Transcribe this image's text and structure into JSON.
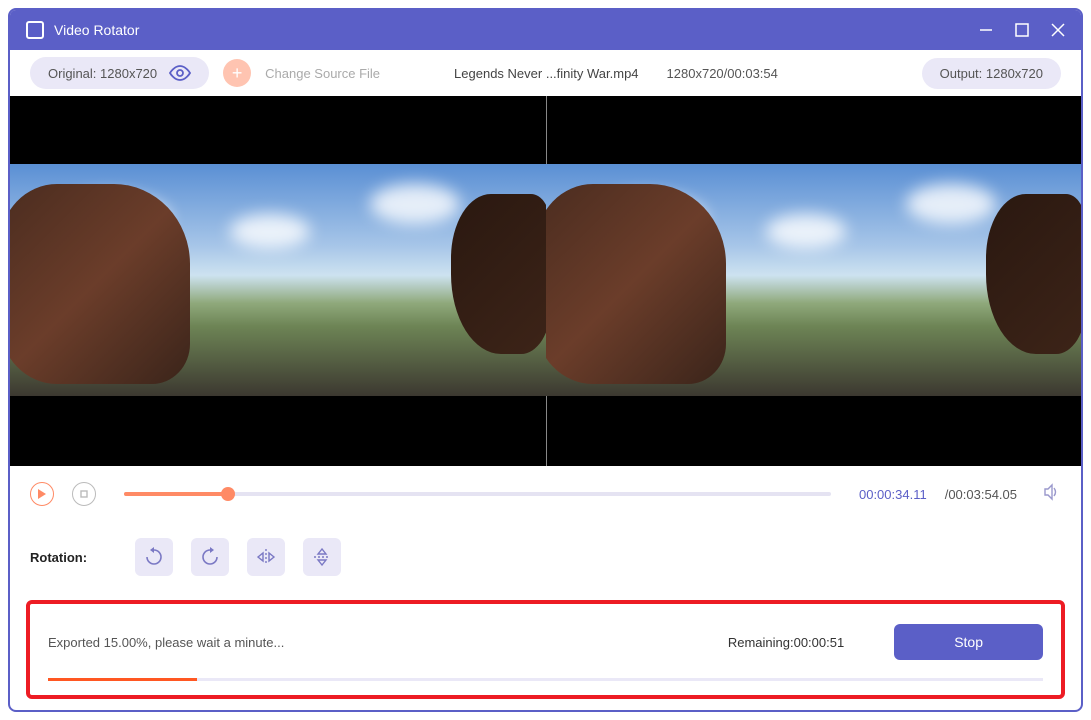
{
  "window": {
    "title": "Video Rotator"
  },
  "infobar": {
    "original_label": "Original: 1280x720",
    "change_source": "Change Source File",
    "filename": "Legends Never ...finity War.mp4",
    "res_dur": "1280x720/00:03:54",
    "output_label": "Output: 1280x720"
  },
  "playback": {
    "current": "00:00:34.11",
    "duration": "/00:03:54.05",
    "progress_pct": 14.7
  },
  "rotation": {
    "label": "Rotation:"
  },
  "export": {
    "status": "Exported 15.00%, please wait a minute...",
    "remaining": "Remaining:00:00:51",
    "stop_label": "Stop",
    "pct": 15
  }
}
